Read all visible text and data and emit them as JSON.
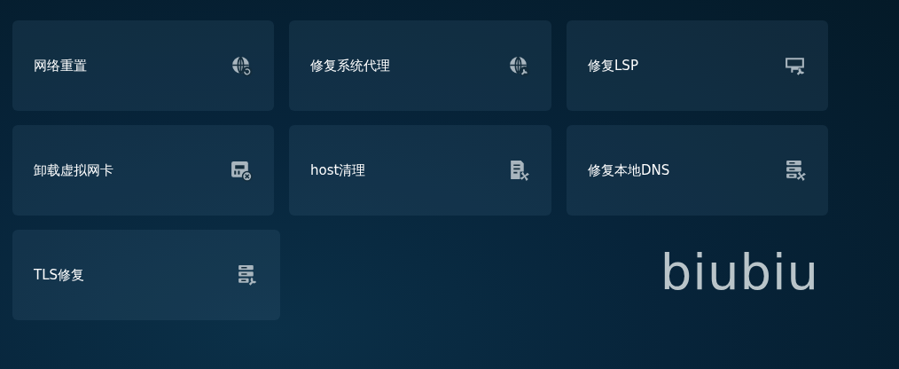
{
  "tools": [
    {
      "label": "网络重置"
    },
    {
      "label": "修复系统代理"
    },
    {
      "label": "修复LSP"
    },
    {
      "label": "卸载虚拟网卡"
    },
    {
      "label": "host清理"
    },
    {
      "label": "修复本地DNS"
    },
    {
      "label": "TLS修复"
    }
  ],
  "logo": "biubiu"
}
